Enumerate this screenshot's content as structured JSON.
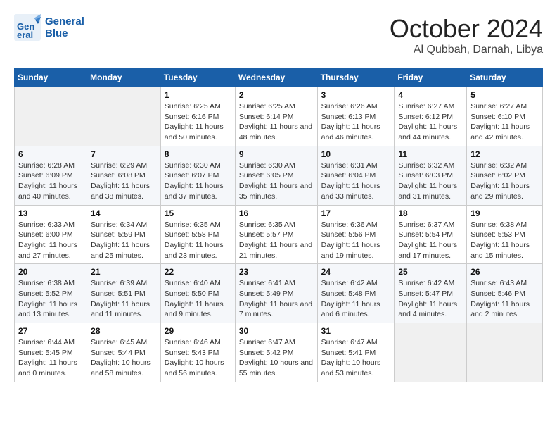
{
  "logo": {
    "line1": "General",
    "line2": "Blue"
  },
  "title": "October 2024",
  "location": "Al Qubbah, Darnah, Libya",
  "weekdays": [
    "Sunday",
    "Monday",
    "Tuesday",
    "Wednesday",
    "Thursday",
    "Friday",
    "Saturday"
  ],
  "weeks": [
    [
      {
        "day": "",
        "info": ""
      },
      {
        "day": "",
        "info": ""
      },
      {
        "day": "1",
        "info": "Sunrise: 6:25 AM\nSunset: 6:16 PM\nDaylight: 11 hours and 50 minutes."
      },
      {
        "day": "2",
        "info": "Sunrise: 6:25 AM\nSunset: 6:14 PM\nDaylight: 11 hours and 48 minutes."
      },
      {
        "day": "3",
        "info": "Sunrise: 6:26 AM\nSunset: 6:13 PM\nDaylight: 11 hours and 46 minutes."
      },
      {
        "day": "4",
        "info": "Sunrise: 6:27 AM\nSunset: 6:12 PM\nDaylight: 11 hours and 44 minutes."
      },
      {
        "day": "5",
        "info": "Sunrise: 6:27 AM\nSunset: 6:10 PM\nDaylight: 11 hours and 42 minutes."
      }
    ],
    [
      {
        "day": "6",
        "info": "Sunrise: 6:28 AM\nSunset: 6:09 PM\nDaylight: 11 hours and 40 minutes."
      },
      {
        "day": "7",
        "info": "Sunrise: 6:29 AM\nSunset: 6:08 PM\nDaylight: 11 hours and 38 minutes."
      },
      {
        "day": "8",
        "info": "Sunrise: 6:30 AM\nSunset: 6:07 PM\nDaylight: 11 hours and 37 minutes."
      },
      {
        "day": "9",
        "info": "Sunrise: 6:30 AM\nSunset: 6:05 PM\nDaylight: 11 hours and 35 minutes."
      },
      {
        "day": "10",
        "info": "Sunrise: 6:31 AM\nSunset: 6:04 PM\nDaylight: 11 hours and 33 minutes."
      },
      {
        "day": "11",
        "info": "Sunrise: 6:32 AM\nSunset: 6:03 PM\nDaylight: 11 hours and 31 minutes."
      },
      {
        "day": "12",
        "info": "Sunrise: 6:32 AM\nSunset: 6:02 PM\nDaylight: 11 hours and 29 minutes."
      }
    ],
    [
      {
        "day": "13",
        "info": "Sunrise: 6:33 AM\nSunset: 6:00 PM\nDaylight: 11 hours and 27 minutes."
      },
      {
        "day": "14",
        "info": "Sunrise: 6:34 AM\nSunset: 5:59 PM\nDaylight: 11 hours and 25 minutes."
      },
      {
        "day": "15",
        "info": "Sunrise: 6:35 AM\nSunset: 5:58 PM\nDaylight: 11 hours and 23 minutes."
      },
      {
        "day": "16",
        "info": "Sunrise: 6:35 AM\nSunset: 5:57 PM\nDaylight: 11 hours and 21 minutes."
      },
      {
        "day": "17",
        "info": "Sunrise: 6:36 AM\nSunset: 5:56 PM\nDaylight: 11 hours and 19 minutes."
      },
      {
        "day": "18",
        "info": "Sunrise: 6:37 AM\nSunset: 5:54 PM\nDaylight: 11 hours and 17 minutes."
      },
      {
        "day": "19",
        "info": "Sunrise: 6:38 AM\nSunset: 5:53 PM\nDaylight: 11 hours and 15 minutes."
      }
    ],
    [
      {
        "day": "20",
        "info": "Sunrise: 6:38 AM\nSunset: 5:52 PM\nDaylight: 11 hours and 13 minutes."
      },
      {
        "day": "21",
        "info": "Sunrise: 6:39 AM\nSunset: 5:51 PM\nDaylight: 11 hours and 11 minutes."
      },
      {
        "day": "22",
        "info": "Sunrise: 6:40 AM\nSunset: 5:50 PM\nDaylight: 11 hours and 9 minutes."
      },
      {
        "day": "23",
        "info": "Sunrise: 6:41 AM\nSunset: 5:49 PM\nDaylight: 11 hours and 7 minutes."
      },
      {
        "day": "24",
        "info": "Sunrise: 6:42 AM\nSunset: 5:48 PM\nDaylight: 11 hours and 6 minutes."
      },
      {
        "day": "25",
        "info": "Sunrise: 6:42 AM\nSunset: 5:47 PM\nDaylight: 11 hours and 4 minutes."
      },
      {
        "day": "26",
        "info": "Sunrise: 6:43 AM\nSunset: 5:46 PM\nDaylight: 11 hours and 2 minutes."
      }
    ],
    [
      {
        "day": "27",
        "info": "Sunrise: 6:44 AM\nSunset: 5:45 PM\nDaylight: 11 hours and 0 minutes."
      },
      {
        "day": "28",
        "info": "Sunrise: 6:45 AM\nSunset: 5:44 PM\nDaylight: 10 hours and 58 minutes."
      },
      {
        "day": "29",
        "info": "Sunrise: 6:46 AM\nSunset: 5:43 PM\nDaylight: 10 hours and 56 minutes."
      },
      {
        "day": "30",
        "info": "Sunrise: 6:47 AM\nSunset: 5:42 PM\nDaylight: 10 hours and 55 minutes."
      },
      {
        "day": "31",
        "info": "Sunrise: 6:47 AM\nSunset: 5:41 PM\nDaylight: 10 hours and 53 minutes."
      },
      {
        "day": "",
        "info": ""
      },
      {
        "day": "",
        "info": ""
      }
    ]
  ]
}
